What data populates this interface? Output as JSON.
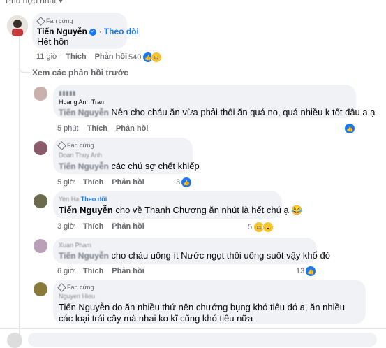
{
  "sort_label": "Phù hợp nhất",
  "top_comment": {
    "badge": "Fan cứng",
    "name": "Tiến Nguyễn",
    "follow": "Theo dõi",
    "text": "Hết hồn",
    "time": "11 giờ",
    "like": "Thích",
    "reply": "Phản hồi",
    "reactions": "540"
  },
  "view_prev": "Xem các phản hồi trước",
  "replies": [
    {
      "name": "Hoang Anh Tran",
      "tag": "Tiến Nguyễn",
      "text": "Nên cho cháu ăn vừa phải thôi ăn quá no, quá nhiều k tốt đâu a ạ",
      "time": "5 phút",
      "like": "Thích",
      "reply": "Phản hồi",
      "reactions": ""
    },
    {
      "badge": "Fan cứng",
      "name": "Doan Thuy Anh",
      "tag": "Tiến Nguyễn",
      "text": "các chú sợ chết khiếp",
      "time": "5 giờ",
      "like": "Thích",
      "reply": "Phản hồi",
      "reactions": "3"
    },
    {
      "name": "Yen Ha",
      "follow": "Theo dõi",
      "tag": "Tiến Nguyễn",
      "text": "cho về Thanh Chương ăn nhút là hết chú ạ 😂",
      "time": "3 giờ",
      "like": "Thích",
      "reply": "Phản hồi",
      "reactions": "5"
    },
    {
      "name": "Xuan Pham",
      "tag": "Tiến Nguyễn",
      "text": "cho cháu uống ít Nước ngọt thôi uống suốt vậy khổ đó",
      "time": "6 giờ",
      "like": "Thích",
      "reply": "Phản hồi",
      "reactions": "13"
    },
    {
      "badge": "Fan cứng",
      "name": "Nguyen Hieu",
      "tag": "Tiến Nguyễn",
      "text": "do ăn nhiều thứ nên chướng bụng khó tiêu đó a, ăn nhiều các loại trái cây mà nhai ko kĩ cũng khó tiêu nữa"
    }
  ],
  "colors": {
    "accent": "#1877f2",
    "bubble": "#f0f2f5",
    "muted": "#65676b"
  }
}
